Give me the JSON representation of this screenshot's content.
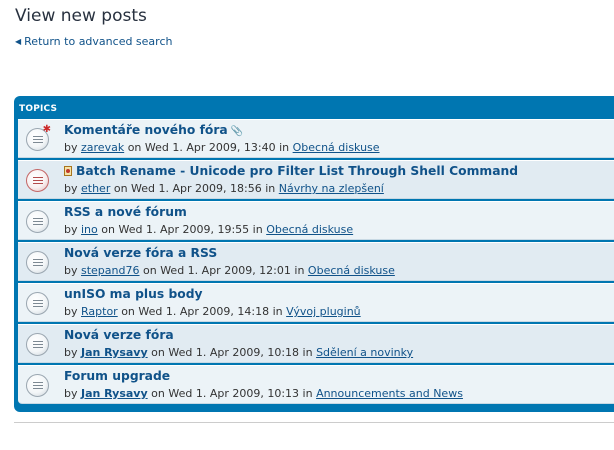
{
  "page": {
    "title": "View new posts",
    "return_link": "Return to advanced search"
  },
  "topics_panel": {
    "header": "TOPICS",
    "meta_by": "by",
    "meta_on": "on",
    "meta_in": "in",
    "topics": [
      {
        "title": "Komentáře nového fóra",
        "icon": "topic-unread-hot-icon",
        "has_attachment": true,
        "author": "zarevak",
        "author_bold": false,
        "date": "Wed 1. Apr 2009, 13:40",
        "forum": "Obecná diskuse"
      },
      {
        "title": "Batch Rename - Unicode pro Filter List Through Shell Command",
        "icon": "topic-locked-icon",
        "has_attachment": false,
        "author": "ether",
        "author_bold": false,
        "date": "Wed 1. Apr 2009, 18:56",
        "forum": "Návrhy na zlepšení"
      },
      {
        "title": "RSS a nové fórum",
        "icon": "topic-read-icon",
        "has_attachment": false,
        "author": "ino",
        "author_bold": false,
        "date": "Wed 1. Apr 2009, 19:55",
        "forum": "Obecná diskuse"
      },
      {
        "title": "Nová verze fóra a RSS",
        "icon": "topic-read-icon",
        "has_attachment": false,
        "author": "stepand76",
        "author_bold": false,
        "date": "Wed 1. Apr 2009, 12:01",
        "forum": "Obecná diskuse"
      },
      {
        "title": "unISO ma plus body",
        "icon": "topic-read-icon",
        "has_attachment": false,
        "author": "Raptor",
        "author_bold": false,
        "date": "Wed 1. Apr 2009, 14:18",
        "forum": "Vývoj pluginů"
      },
      {
        "title": "Nová verze fóra",
        "icon": "topic-read-icon",
        "has_attachment": false,
        "author": "Jan Rysavy",
        "author_bold": true,
        "date": "Wed 1. Apr 2009, 10:18",
        "forum": "Sdělení a novinky"
      },
      {
        "title": "Forum upgrade",
        "icon": "topic-read-icon",
        "has_attachment": false,
        "author": "Jan Rysavy",
        "author_bold": true,
        "date": "Wed 1. Apr 2009, 10:13",
        "forum": "Announcements and News"
      }
    ]
  },
  "colors": {
    "panel_blue": "#0076b1",
    "row_light": "#ecf3f7",
    "row_alt": "#e1ebf2",
    "link_blue": "#105289",
    "title_dark": "#28313f"
  }
}
